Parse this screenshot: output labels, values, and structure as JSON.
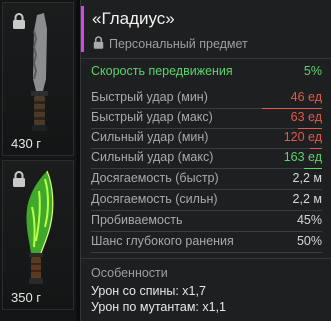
{
  "slots": [
    {
      "weight": "430 г",
      "icon": "combat-knife"
    },
    {
      "weight": "350 г",
      "icon": "glowing-green-blade"
    }
  ],
  "tooltip": {
    "title": "«Гладиус»",
    "subtitle": "Персональный предмет",
    "accent_color": "#d946e6",
    "stats": [
      {
        "label": "Скорость передвижения",
        "value": "5%",
        "style": "speed"
      },
      {
        "label": "Быстрый удар (мин)",
        "value": "46 ед",
        "style": "neg"
      },
      {
        "label": "Быстрый удар (макс)",
        "value": "63 ед",
        "style": "neg"
      },
      {
        "label": "Сильный удар (мин)",
        "value": "120 ед",
        "style": "neg"
      },
      {
        "label": "Сильный удар (макс)",
        "value": "163 ед",
        "style": "pos"
      },
      {
        "label": "Досягаемость (быстр)",
        "value": "2,2 м",
        "style": "plain"
      },
      {
        "label": "Досягаемость (сильн)",
        "value": "2,2 м",
        "style": "plain"
      },
      {
        "label": "Пробиваемость",
        "value": "45%",
        "style": "plain"
      },
      {
        "label": "Шанс глубокого ранения",
        "value": "50%",
        "style": "plain"
      }
    ],
    "features_title": "Особенности",
    "features": [
      "Урон со спины: x1,7",
      "Урон по мутантам: x1,1"
    ]
  }
}
